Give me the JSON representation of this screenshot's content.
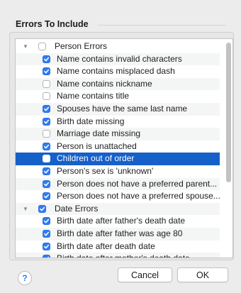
{
  "section_title": "Errors To Include",
  "rows": [
    {
      "label": "Person Errors",
      "checked": false,
      "group": true,
      "selected": false
    },
    {
      "label": "Name contains invalid characters",
      "checked": true,
      "group": false,
      "selected": false
    },
    {
      "label": "Name contains misplaced dash",
      "checked": true,
      "group": false,
      "selected": false
    },
    {
      "label": "Name contains nickname",
      "checked": false,
      "group": false,
      "selected": false
    },
    {
      "label": "Name contains title",
      "checked": false,
      "group": false,
      "selected": false
    },
    {
      "label": "Spouses have the same last name",
      "checked": true,
      "group": false,
      "selected": false
    },
    {
      "label": "Birth date missing",
      "checked": true,
      "group": false,
      "selected": false
    },
    {
      "label": "Marriage date missing",
      "checked": false,
      "group": false,
      "selected": false
    },
    {
      "label": "Person is unattached",
      "checked": true,
      "group": false,
      "selected": false
    },
    {
      "label": "Children out of order",
      "checked": false,
      "group": false,
      "selected": true
    },
    {
      "label": "Person's sex is 'unknown'",
      "checked": true,
      "group": false,
      "selected": false
    },
    {
      "label": "Person does not have a preferred parent...",
      "checked": true,
      "group": false,
      "selected": false
    },
    {
      "label": "Person does not have a preferred spouse...",
      "checked": true,
      "group": false,
      "selected": false
    },
    {
      "label": "Date Errors",
      "checked": true,
      "group": true,
      "selected": false
    },
    {
      "label": "Birth date after father's death date",
      "checked": true,
      "group": false,
      "selected": false
    },
    {
      "label": "Birth date after father was age 80",
      "checked": true,
      "group": false,
      "selected": false
    },
    {
      "label": "Birth date after death date",
      "checked": true,
      "group": false,
      "selected": false
    },
    {
      "label": "Birth date after mother's death date",
      "checked": true,
      "group": false,
      "selected": false
    }
  ],
  "buttons": {
    "help": "?",
    "cancel": "Cancel",
    "ok": "OK"
  },
  "colors": {
    "selection": "#1660c9",
    "checkbox_on": "#2f7cf6",
    "window_bg": "#ececec"
  }
}
